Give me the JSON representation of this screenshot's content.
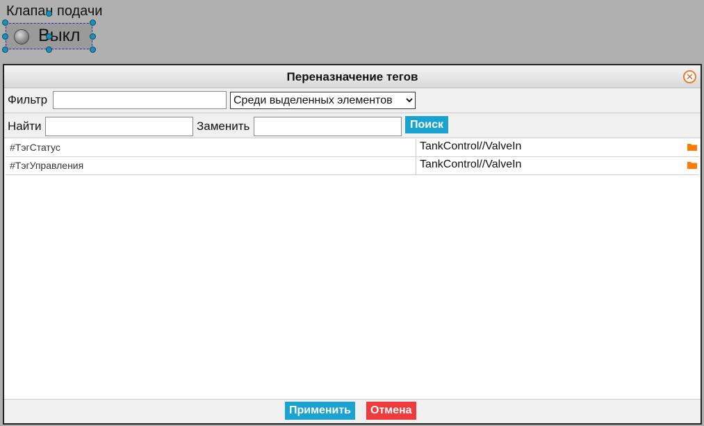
{
  "widget": {
    "label": "Клапан подачи",
    "state": "Выкл"
  },
  "dialog": {
    "title": "Переназначение тегов",
    "filter_label": "Фильтр",
    "filter_value": "",
    "scope_selected": "Среди выделенных элементов",
    "find_label": "Найти",
    "find_value": "",
    "replace_label": "Заменить",
    "replace_value": "",
    "search_button": "Поиск",
    "rows": [
      {
        "source": "#ТэгСтатус",
        "target": "TankControl//ValveIn"
      },
      {
        "source": "#ТэгУправления",
        "target": "TankControl//ValveIn"
      }
    ],
    "apply_button": "Применить",
    "cancel_button": "Отмена"
  },
  "icons": {
    "close": "close-icon",
    "folder": "folder-icon",
    "lamp": "indicator-lamp-icon"
  },
  "colors": {
    "accent": "#1aa3d1",
    "danger": "#ee3b3b",
    "folder": "#ff7a00",
    "selection": "#2a2aa8"
  }
}
